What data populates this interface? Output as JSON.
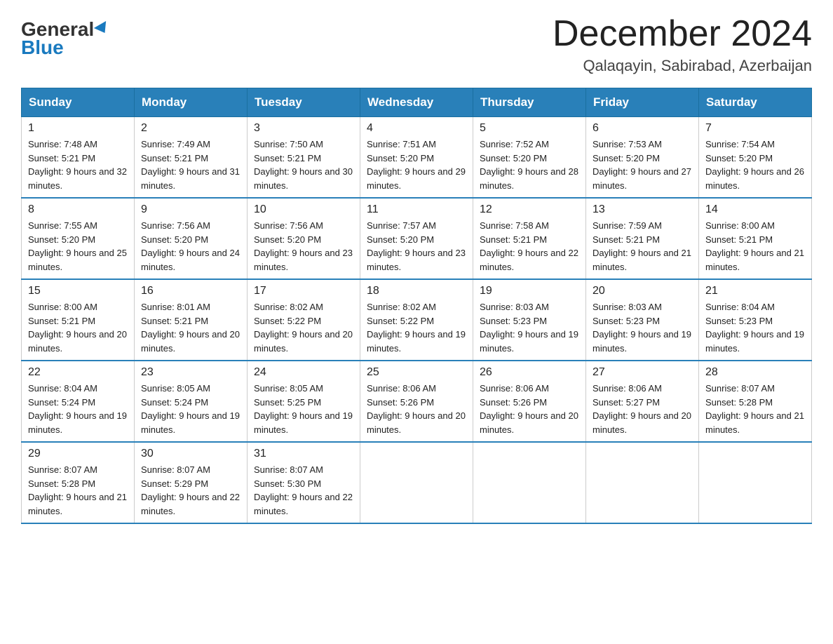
{
  "header": {
    "logo_general": "General",
    "logo_blue": "Blue",
    "month_title": "December 2024",
    "subtitle": "Qalaqayin, Sabirabad, Azerbaijan"
  },
  "days_of_week": [
    "Sunday",
    "Monday",
    "Tuesday",
    "Wednesday",
    "Thursday",
    "Friday",
    "Saturday"
  ],
  "weeks": [
    [
      {
        "day": "1",
        "sunrise": "7:48 AM",
        "sunset": "5:21 PM",
        "daylight": "9 hours and 32 minutes."
      },
      {
        "day": "2",
        "sunrise": "7:49 AM",
        "sunset": "5:21 PM",
        "daylight": "9 hours and 31 minutes."
      },
      {
        "day": "3",
        "sunrise": "7:50 AM",
        "sunset": "5:21 PM",
        "daylight": "9 hours and 30 minutes."
      },
      {
        "day": "4",
        "sunrise": "7:51 AM",
        "sunset": "5:20 PM",
        "daylight": "9 hours and 29 minutes."
      },
      {
        "day": "5",
        "sunrise": "7:52 AM",
        "sunset": "5:20 PM",
        "daylight": "9 hours and 28 minutes."
      },
      {
        "day": "6",
        "sunrise": "7:53 AM",
        "sunset": "5:20 PM",
        "daylight": "9 hours and 27 minutes."
      },
      {
        "day": "7",
        "sunrise": "7:54 AM",
        "sunset": "5:20 PM",
        "daylight": "9 hours and 26 minutes."
      }
    ],
    [
      {
        "day": "8",
        "sunrise": "7:55 AM",
        "sunset": "5:20 PM",
        "daylight": "9 hours and 25 minutes."
      },
      {
        "day": "9",
        "sunrise": "7:56 AM",
        "sunset": "5:20 PM",
        "daylight": "9 hours and 24 minutes."
      },
      {
        "day": "10",
        "sunrise": "7:56 AM",
        "sunset": "5:20 PM",
        "daylight": "9 hours and 23 minutes."
      },
      {
        "day": "11",
        "sunrise": "7:57 AM",
        "sunset": "5:20 PM",
        "daylight": "9 hours and 23 minutes."
      },
      {
        "day": "12",
        "sunrise": "7:58 AM",
        "sunset": "5:21 PM",
        "daylight": "9 hours and 22 minutes."
      },
      {
        "day": "13",
        "sunrise": "7:59 AM",
        "sunset": "5:21 PM",
        "daylight": "9 hours and 21 minutes."
      },
      {
        "day": "14",
        "sunrise": "8:00 AM",
        "sunset": "5:21 PM",
        "daylight": "9 hours and 21 minutes."
      }
    ],
    [
      {
        "day": "15",
        "sunrise": "8:00 AM",
        "sunset": "5:21 PM",
        "daylight": "9 hours and 20 minutes."
      },
      {
        "day": "16",
        "sunrise": "8:01 AM",
        "sunset": "5:21 PM",
        "daylight": "9 hours and 20 minutes."
      },
      {
        "day": "17",
        "sunrise": "8:02 AM",
        "sunset": "5:22 PM",
        "daylight": "9 hours and 20 minutes."
      },
      {
        "day": "18",
        "sunrise": "8:02 AM",
        "sunset": "5:22 PM",
        "daylight": "9 hours and 19 minutes."
      },
      {
        "day": "19",
        "sunrise": "8:03 AM",
        "sunset": "5:23 PM",
        "daylight": "9 hours and 19 minutes."
      },
      {
        "day": "20",
        "sunrise": "8:03 AM",
        "sunset": "5:23 PM",
        "daylight": "9 hours and 19 minutes."
      },
      {
        "day": "21",
        "sunrise": "8:04 AM",
        "sunset": "5:23 PM",
        "daylight": "9 hours and 19 minutes."
      }
    ],
    [
      {
        "day": "22",
        "sunrise": "8:04 AM",
        "sunset": "5:24 PM",
        "daylight": "9 hours and 19 minutes."
      },
      {
        "day": "23",
        "sunrise": "8:05 AM",
        "sunset": "5:24 PM",
        "daylight": "9 hours and 19 minutes."
      },
      {
        "day": "24",
        "sunrise": "8:05 AM",
        "sunset": "5:25 PM",
        "daylight": "9 hours and 19 minutes."
      },
      {
        "day": "25",
        "sunrise": "8:06 AM",
        "sunset": "5:26 PM",
        "daylight": "9 hours and 20 minutes."
      },
      {
        "day": "26",
        "sunrise": "8:06 AM",
        "sunset": "5:26 PM",
        "daylight": "9 hours and 20 minutes."
      },
      {
        "day": "27",
        "sunrise": "8:06 AM",
        "sunset": "5:27 PM",
        "daylight": "9 hours and 20 minutes."
      },
      {
        "day": "28",
        "sunrise": "8:07 AM",
        "sunset": "5:28 PM",
        "daylight": "9 hours and 21 minutes."
      }
    ],
    [
      {
        "day": "29",
        "sunrise": "8:07 AM",
        "sunset": "5:28 PM",
        "daylight": "9 hours and 21 minutes."
      },
      {
        "day": "30",
        "sunrise": "8:07 AM",
        "sunset": "5:29 PM",
        "daylight": "9 hours and 22 minutes."
      },
      {
        "day": "31",
        "sunrise": "8:07 AM",
        "sunset": "5:30 PM",
        "daylight": "9 hours and 22 minutes."
      },
      null,
      null,
      null,
      null
    ]
  ]
}
